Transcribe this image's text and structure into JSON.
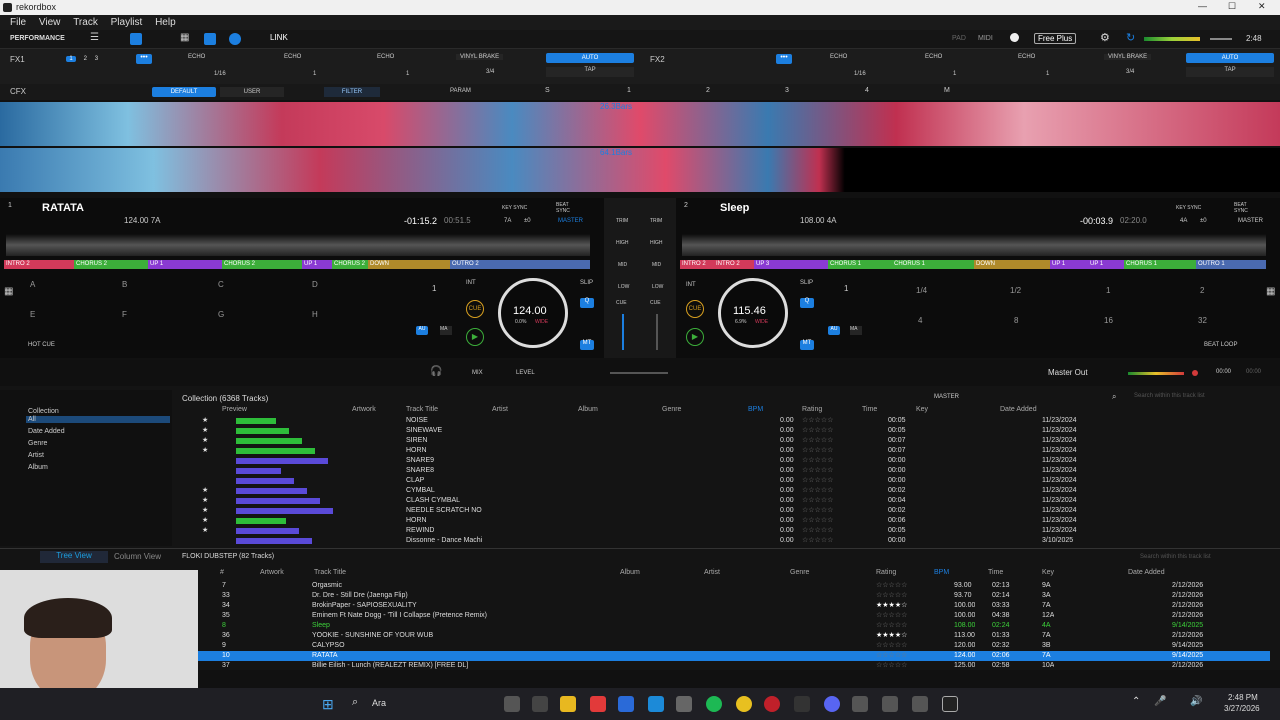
{
  "window": {
    "title": "rekordbox"
  },
  "menu": [
    "File",
    "View",
    "Track",
    "Playlist",
    "Help"
  ],
  "toolbar": {
    "mode": "PERFORMANCE",
    "link": "LINK",
    "pad": "PAD",
    "midi": "MIDI",
    "free_plus": "Free Plus",
    "time": "2:48"
  },
  "fx1": {
    "label": "FX1",
    "beats": [
      "1",
      "2",
      "3",
      "4",
      "8",
      "16",
      "1/16"
    ],
    "effects": [
      "ECHO",
      "ECHO",
      "ECHO",
      "VINYL BRAKE"
    ],
    "auto": "AUTO",
    "tap": "TAP",
    "frac": "3/4",
    "val1": "1/16",
    "val2": "1",
    "val3": "1"
  },
  "fx2": {
    "label": "FX2",
    "effects": [
      "ECHO",
      "ECHO",
      "ECHO",
      "VINYL BRAKE"
    ],
    "auto": "AUTO",
    "tap": "TAP",
    "frac": "3/4",
    "val1": "1/16",
    "val2": "1",
    "val3": "1"
  },
  "cfx": {
    "label": "CFX",
    "default": "DEFAULT",
    "user": "USER",
    "filter": "FILTER",
    "param": "PARAM",
    "s": "S",
    "m": "M",
    "nums": [
      "1",
      "2",
      "3",
      "4"
    ]
  },
  "waves": {
    "bars1": "26.3Bars",
    "bars2": "64.1Bars"
  },
  "deck1": {
    "num": "1",
    "title": "RATATA",
    "bpm_key": "124.00 7A",
    "remain": "-01:15.2",
    "total": "00:51.5",
    "key_sync": "KEY SYNC",
    "beat_sync": "BEAT SYNC",
    "key": "7A",
    "pm": "±0",
    "master": "MASTER",
    "sections": [
      "INTRO 2",
      "CHORUS 2",
      "UP 1",
      "CHORUS 2",
      "UP 1",
      "CHORUS 2",
      "DOWN",
      "OUTRO 2"
    ],
    "pads": [
      "A",
      "B",
      "C",
      "D",
      "E",
      "F",
      "G",
      "H"
    ],
    "hot_cue": "HOT CUE",
    "jog_bpm": "124.00",
    "jog_pct": "0.0%",
    "jog_wide": "WIDE",
    "beat": "1",
    "int": "INT",
    "cue": "CUE",
    "slip": "SLIP",
    "q": "Q",
    "au": "AU",
    "ma": "MA",
    "mt": "MT"
  },
  "deck2": {
    "num": "2",
    "title": "Sleep",
    "bpm_key": "108.00 4A",
    "remain": "-00:03.9",
    "total": "02:20.0",
    "key_sync": "KEY SYNC",
    "beat_sync": "BEAT SYNC",
    "key": "4A",
    "pm": "±0",
    "master": "MASTER",
    "sections": [
      "INTRO 2",
      "INTRO 2",
      "UP 3",
      "CHORUS 1",
      "CHORUS 1",
      "DOWN",
      "UP 1",
      "UP 1",
      "CHORUS 1",
      "OUTRO 1"
    ],
    "loops": [
      "1/4",
      "1/2",
      "1",
      "2",
      "4",
      "8",
      "16",
      "32"
    ],
    "beat_loop": "BEAT LOOP",
    "jog_bpm": "115.46",
    "jog_pct": "6.9%",
    "jog_wide": "WIDE",
    "beat": "1",
    "int": "INT",
    "cue": "CUE",
    "slip": "SLIP",
    "q": "Q",
    "au": "AU",
    "ma": "MA",
    "mt": "MT"
  },
  "mixer": {
    "trim": "TRIM",
    "high": "HIGH",
    "mid": "MID",
    "low": "LOW",
    "cue": "CUE",
    "mix": "MIX",
    "level": "LEVEL",
    "master_out": "Master Out",
    "time1": "00:00",
    "time2": "00:00"
  },
  "browser": {
    "tree": [
      "Collection",
      "All",
      "Date Added",
      "Genre",
      "Artist",
      "Album"
    ],
    "title": "Collection (6368 Tracks)",
    "master": "MASTER",
    "search": "Search within this track list",
    "columns": [
      "Preview",
      "Artwork",
      "Track Title",
      "Artist",
      "Album",
      "Genre",
      "BPM",
      "Rating",
      "Time",
      "Key",
      "Date Added"
    ],
    "rows": [
      [
        "NOISE",
        "0.00",
        "00:05",
        "11/23/2024"
      ],
      [
        "SINEWAVE",
        "0.00",
        "00:05",
        "11/23/2024"
      ],
      [
        "SIREN",
        "0.00",
        "00:07",
        "11/23/2024"
      ],
      [
        "HORN",
        "0.00",
        "00:07",
        "11/23/2024"
      ],
      [
        "SNARE9",
        "0.00",
        "00:00",
        "11/23/2024"
      ],
      [
        "SNARE8",
        "0.00",
        "00:00",
        "11/23/2024"
      ],
      [
        "CLAP",
        "0.00",
        "00:00",
        "11/23/2024"
      ],
      [
        "CYMBAL",
        "0.00",
        "00:02",
        "11/23/2024"
      ],
      [
        "CLASH CYMBAL",
        "0.00",
        "00:04",
        "11/23/2024"
      ],
      [
        "NEEDLE SCRATCH NO",
        "0.00",
        "00:02",
        "11/23/2024"
      ],
      [
        "HORN",
        "0.00",
        "00:06",
        "11/23/2024"
      ],
      [
        "REWIND",
        "0.00",
        "00:05",
        "11/23/2024"
      ],
      [
        "Dissonne - Dance Machi",
        "0.00",
        "00:00",
        "3/10/2025"
      ]
    ]
  },
  "playlist": {
    "tree_view": "Tree View",
    "column_view": "Column View",
    "title": "FLOKI DUBSTEP (82 Tracks)",
    "search": "Search within this track list",
    "columns": [
      "#",
      "Artwork",
      "Track Title",
      "Album",
      "Artist",
      "Genre",
      "Rating",
      "BPM",
      "Time",
      "Key",
      "Date Added"
    ],
    "rows": [
      [
        "7",
        "Orgasmic",
        "93.00",
        "02:13",
        "9A",
        "2/12/2026"
      ],
      [
        "33",
        "Dr. Dre - Still Dre (Jaenga Flip)",
        "93.70",
        "02:14",
        "3A",
        "2/12/2026"
      ],
      [
        "34",
        "BrokinPaper - SAPIOSEXUALITY",
        "100.00",
        "03:33",
        "7A",
        "2/12/2026"
      ],
      [
        "35",
        "Eminem Ft Nate Dogg - 'Till I Collapse (Pretence Remix)",
        "100.00",
        "04:38",
        "12A",
        "2/12/2026"
      ],
      [
        "8",
        "Sleep",
        "108.00",
        "02:24",
        "4A",
        "9/14/2025"
      ],
      [
        "36",
        "YOOKIE - SUNSHINE OF YOUR WUB",
        "113.00",
        "01:33",
        "7A",
        "2/12/2026"
      ],
      [
        "9",
        "CALYPSO",
        "120.00",
        "02:32",
        "3B",
        "9/14/2025"
      ],
      [
        "10",
        "RATATA",
        "124.00",
        "02:06",
        "7A",
        "9/14/2025"
      ],
      [
        "37",
        "Billie Eilish - Lunch (REALEZT REMIX) [FREE DL]",
        "125.00",
        "02:58",
        "10A",
        "2/12/2026"
      ]
    ]
  },
  "taskbar": {
    "search": "Ara",
    "time": "2:48 PM",
    "date": "3/27/2026"
  }
}
